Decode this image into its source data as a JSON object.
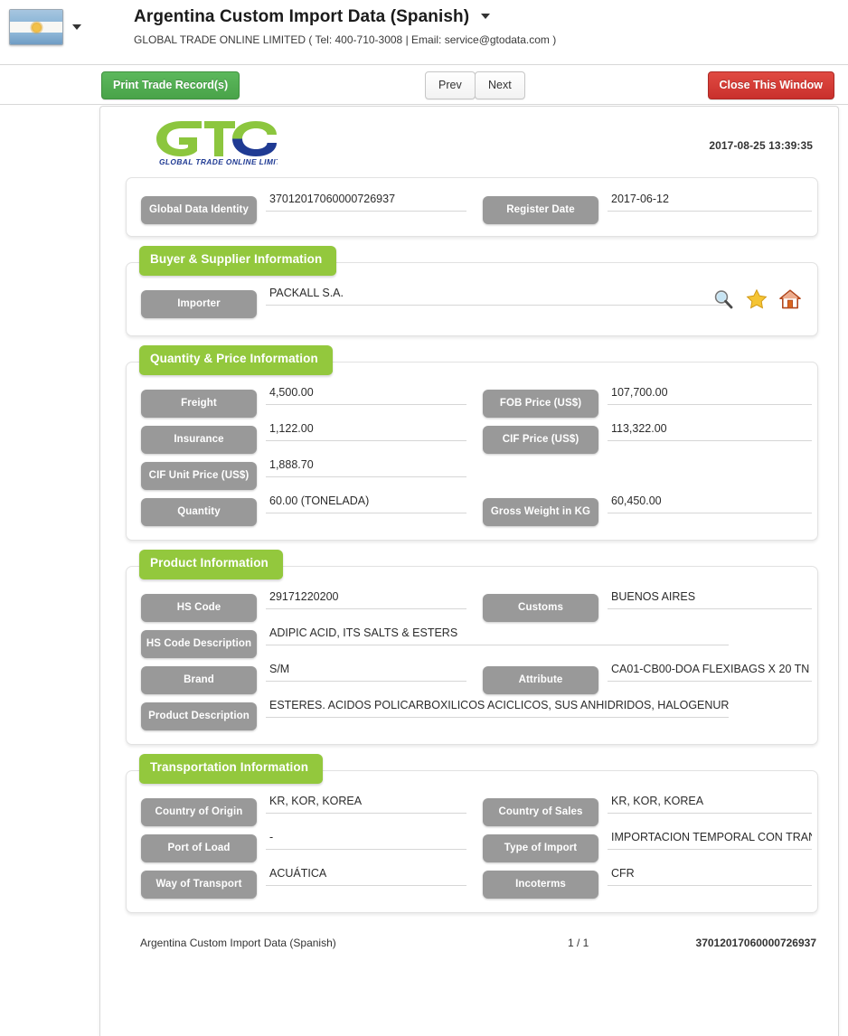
{
  "header": {
    "flag_icon": "argentina-flag-icon",
    "flag_dropdown_icon": "chevron-down-icon",
    "title": "Argentina Custom Import Data (Spanish)",
    "title_dropdown_icon": "chevron-down-icon",
    "subtitle": "GLOBAL TRADE ONLINE LIMITED ( Tel: 400-710-3008 | Email: service@gtodata.com )"
  },
  "toolbar": {
    "print_label": "Print Trade Record(s)",
    "prev_label": "Prev",
    "next_label": "Next",
    "close_label": "Close This Window",
    "print_color": "#49a349",
    "close_color": "#c9302c"
  },
  "document": {
    "logo_name": "gto-logo",
    "logo_text": "GLOBAL TRADE  ONLINE LIMITED",
    "timestamp": "2017-08-25 13:39:35"
  },
  "identity": {
    "data_identity_label": "Global Data Identity",
    "data_identity_value": "37012017060000726937",
    "register_date_label": "Register Date",
    "register_date_value": "2017-06-12"
  },
  "buyer_supplier": {
    "section_title": "Buyer & Supplier Information",
    "importer_label": "Importer",
    "importer_value": "PACKALL S.A.",
    "icons": [
      {
        "name": "search-icon",
        "title": "Search"
      },
      {
        "name": "star-icon",
        "title": "Favorite"
      },
      {
        "name": "home-icon",
        "title": "Home"
      }
    ]
  },
  "quantity_price": {
    "section_title": "Quantity & Price Information",
    "freight_label": "Freight",
    "freight_value": "4,500.00",
    "fob_price_label": "FOB Price (US$)",
    "fob_price_value": "107,700.00",
    "insurance_label": "Insurance",
    "insurance_value": "1,122.00",
    "cif_price_label": "CIF Price (US$)",
    "cif_price_value": "113,322.00",
    "cif_unit_price_label": "CIF Unit Price (US$)",
    "cif_unit_price_value": "1,888.70",
    "quantity_label": "Quantity",
    "quantity_value": "60.00 (TONELADA)",
    "gross_weight_label": "Gross Weight in KG",
    "gross_weight_value": "60,450.00"
  },
  "product": {
    "section_title": "Product Information",
    "hs_code_label": "HS Code",
    "hs_code_value": "29171220200",
    "customs_label": "Customs",
    "customs_value": "BUENOS AIRES",
    "hs_code_desc_label": "HS Code Description",
    "hs_code_desc_value": "ADIPIC ACID, ITS SALTS & ESTERS",
    "brand_label": "Brand",
    "brand_value": "S/M",
    "attribute_label": "Attribute",
    "attribute_value": "CA01-CB00-DOA FLEXIBAGS X 20 TN",
    "product_desc_label": "Product Description",
    "product_desc_value": "ESTERES. ACIDOS POLICARBOXILICOS ACICLICOS, SUS ANHIDRIDOS, HALOGENUROS, P"
  },
  "transportation": {
    "section_title": "Transportation Information",
    "country_origin_label": "Country of Origin",
    "country_origin_value": "KR, KOR, KOREA",
    "country_sales_label": "Country of Sales",
    "country_sales_value": "KR, KOR, KOREA",
    "port_load_label": "Port of Load",
    "port_load_value": "-",
    "type_import_label": "Type of Import",
    "type_import_value": "IMPORTACION TEMPORAL CON TRANSF",
    "way_transport_label": "Way of Transport",
    "way_transport_value": "ACUÁTICA",
    "incoterms_label": "Incoterms",
    "incoterms_value": "CFR"
  },
  "footer": {
    "left": "Argentina Custom Import Data (Spanish)",
    "center": "1 / 1",
    "right": "37012017060000726937"
  },
  "theme": {
    "section_green": "#93c83d",
    "pill_gray": "#999999"
  }
}
